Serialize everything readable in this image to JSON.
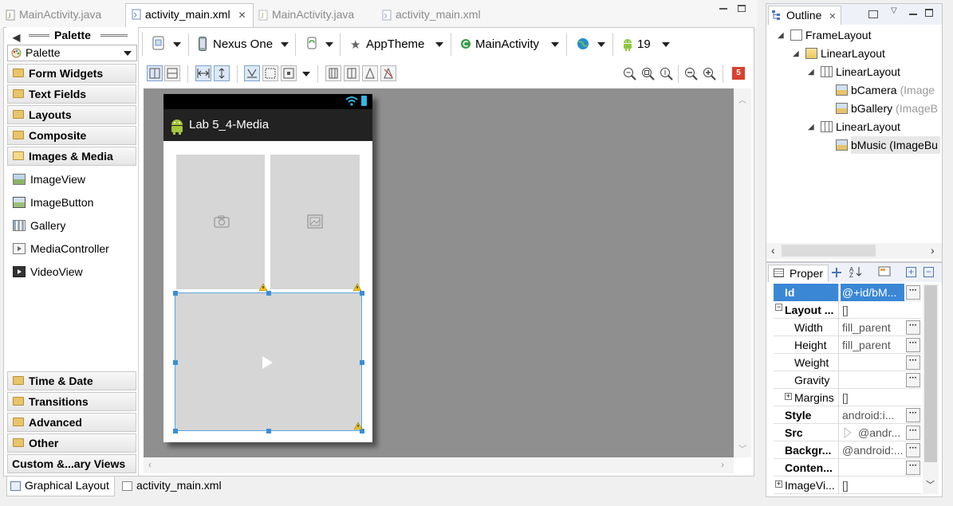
{
  "editor_tabs": [
    {
      "label": "MainActivity.java",
      "active": false
    },
    {
      "label": "activity_main.xml",
      "active": true
    },
    {
      "label": "MainActivity.java",
      "active": false
    },
    {
      "label": "activity_main.xml",
      "active": false
    }
  ],
  "palette": {
    "title": "Palette",
    "selector_value": "Palette",
    "categories_top": [
      "Form Widgets",
      "Text Fields",
      "Layouts",
      "Composite",
      "Images & Media"
    ],
    "items": [
      "ImageView",
      "ImageButton",
      "Gallery",
      "MediaController",
      "VideoView"
    ],
    "categories_bottom": [
      "Time & Date",
      "Transitions",
      "Advanced",
      "Other"
    ],
    "custom": "Custom &...ary Views"
  },
  "toolbar": {
    "device": "Nexus One",
    "theme": "AppTheme",
    "activity": "MainActivity",
    "api_level": "19",
    "error_count": "5"
  },
  "device_preview": {
    "app_title": "Lab 5_4-Media"
  },
  "bottom_tabs": [
    {
      "label": "Graphical Layout",
      "active": true
    },
    {
      "label": "activity_main.xml",
      "active": false
    }
  ],
  "outline": {
    "tab_label": "Outline",
    "nodes": [
      {
        "label": "FrameLayout",
        "suffix": ""
      },
      {
        "label": "LinearLayout",
        "suffix": ""
      },
      {
        "label": "LinearLayout",
        "suffix": ""
      },
      {
        "label": "bCamera",
        "suffix": "(Image"
      },
      {
        "label": "bGallery",
        "suffix": "(ImageB"
      },
      {
        "label": "LinearLayout",
        "suffix": ""
      },
      {
        "label": "bMusic",
        "suffix": "(ImageBu"
      }
    ]
  },
  "properties": {
    "tab_label": "Proper",
    "rows": [
      {
        "name": "Id",
        "value": "@+id/bM...",
        "bold": true,
        "selected": true
      },
      {
        "name": "Layout ...",
        "value": "[]",
        "bold": true,
        "selected": false
      },
      {
        "name": "Width",
        "value": "fill_parent",
        "bold": false,
        "selected": false
      },
      {
        "name": "Height",
        "value": "fill_parent",
        "bold": false,
        "selected": false
      },
      {
        "name": "Weight",
        "value": "",
        "bold": false,
        "selected": false
      },
      {
        "name": "Gravity",
        "value": "",
        "bold": false,
        "selected": false
      },
      {
        "name": "Margins",
        "value": "[]",
        "bold": false,
        "selected": false
      },
      {
        "name": "Style",
        "value": "android:i...",
        "bold": true,
        "selected": false
      },
      {
        "name": "Src",
        "value": "@andr...",
        "bold": true,
        "selected": false
      },
      {
        "name": "Backgr...",
        "value": "@android:...",
        "bold": true,
        "selected": false
      },
      {
        "name": "Conten...",
        "value": "",
        "bold": true,
        "selected": false
      },
      {
        "name": "ImageVi...",
        "value": "[]",
        "bold": false,
        "selected": false
      }
    ]
  }
}
